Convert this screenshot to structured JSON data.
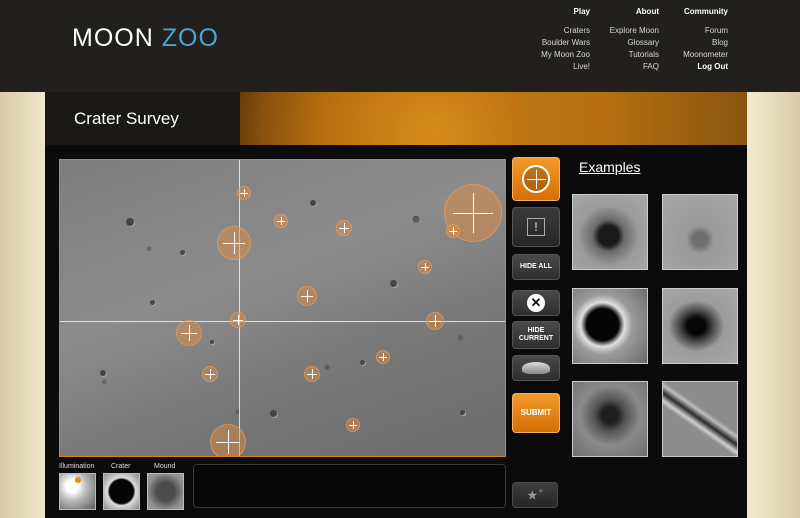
{
  "logo": {
    "word1": "MOON",
    "word2": "ZOO"
  },
  "nav": {
    "play": {
      "heading": "Play",
      "items": [
        "Craters",
        "Boulder Wars",
        "My Moon Zoo",
        "Live!"
      ]
    },
    "about": {
      "heading": "About",
      "items": [
        "Explore Moon",
        "Glossary",
        "Tutorials",
        "FAQ"
      ]
    },
    "community": {
      "heading": "Community",
      "items": [
        "Forum",
        "Blog",
        "Moonometer"
      ],
      "logout": "Log Out"
    }
  },
  "banner": {
    "title": "Crater Survey"
  },
  "tools": {
    "hide_all": "HIDE ALL",
    "hide_current": "HIDE CURRENT",
    "submit": "SUBMIT"
  },
  "examples": {
    "title": "Examples"
  },
  "mini": {
    "illumination": "Illumination",
    "crater": "Crater",
    "mound": "Mound"
  },
  "icons": {
    "crater_tool": "crosshair-ring-icon",
    "flag": "exclamation-icon",
    "delete": "close-circle-icon",
    "boulder": "boulder-icon",
    "favourite": "star-plus-icon"
  },
  "colors": {
    "accent": "#e0801a",
    "logo_zoo": "#4aa3d6"
  }
}
